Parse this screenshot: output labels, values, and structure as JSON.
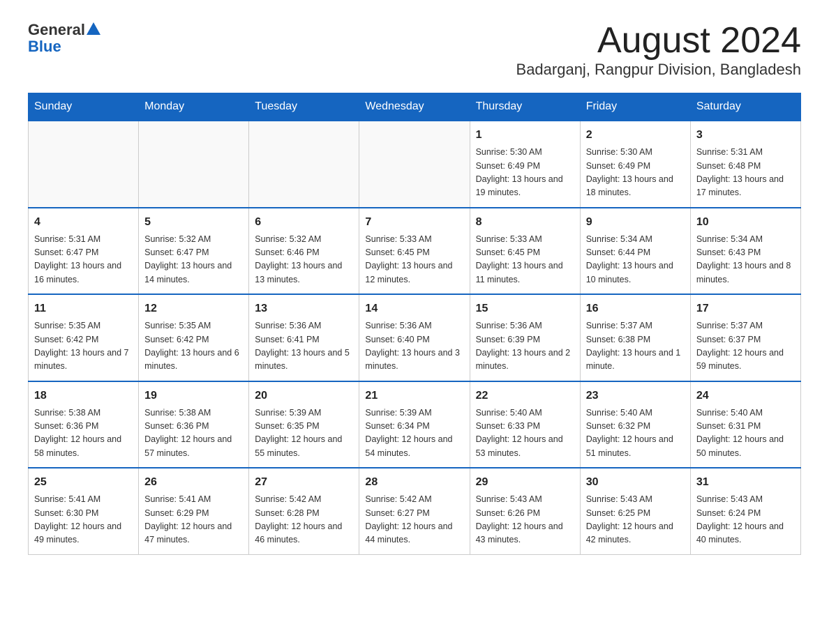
{
  "header": {
    "logo_general": "General",
    "logo_blue": "Blue",
    "month_title": "August 2024",
    "location": "Badarganj, Rangpur Division, Bangladesh"
  },
  "days_of_week": [
    "Sunday",
    "Monday",
    "Tuesday",
    "Wednesday",
    "Thursday",
    "Friday",
    "Saturday"
  ],
  "weeks": [
    [
      {
        "day": "",
        "sunrise": "",
        "sunset": "",
        "daylight": ""
      },
      {
        "day": "",
        "sunrise": "",
        "sunset": "",
        "daylight": ""
      },
      {
        "day": "",
        "sunrise": "",
        "sunset": "",
        "daylight": ""
      },
      {
        "day": "",
        "sunrise": "",
        "sunset": "",
        "daylight": ""
      },
      {
        "day": "1",
        "sunrise": "Sunrise: 5:30 AM",
        "sunset": "Sunset: 6:49 PM",
        "daylight": "Daylight: 13 hours and 19 minutes."
      },
      {
        "day": "2",
        "sunrise": "Sunrise: 5:30 AM",
        "sunset": "Sunset: 6:49 PM",
        "daylight": "Daylight: 13 hours and 18 minutes."
      },
      {
        "day": "3",
        "sunrise": "Sunrise: 5:31 AM",
        "sunset": "Sunset: 6:48 PM",
        "daylight": "Daylight: 13 hours and 17 minutes."
      }
    ],
    [
      {
        "day": "4",
        "sunrise": "Sunrise: 5:31 AM",
        "sunset": "Sunset: 6:47 PM",
        "daylight": "Daylight: 13 hours and 16 minutes."
      },
      {
        "day": "5",
        "sunrise": "Sunrise: 5:32 AM",
        "sunset": "Sunset: 6:47 PM",
        "daylight": "Daylight: 13 hours and 14 minutes."
      },
      {
        "day": "6",
        "sunrise": "Sunrise: 5:32 AM",
        "sunset": "Sunset: 6:46 PM",
        "daylight": "Daylight: 13 hours and 13 minutes."
      },
      {
        "day": "7",
        "sunrise": "Sunrise: 5:33 AM",
        "sunset": "Sunset: 6:45 PM",
        "daylight": "Daylight: 13 hours and 12 minutes."
      },
      {
        "day": "8",
        "sunrise": "Sunrise: 5:33 AM",
        "sunset": "Sunset: 6:45 PM",
        "daylight": "Daylight: 13 hours and 11 minutes."
      },
      {
        "day": "9",
        "sunrise": "Sunrise: 5:34 AM",
        "sunset": "Sunset: 6:44 PM",
        "daylight": "Daylight: 13 hours and 10 minutes."
      },
      {
        "day": "10",
        "sunrise": "Sunrise: 5:34 AM",
        "sunset": "Sunset: 6:43 PM",
        "daylight": "Daylight: 13 hours and 8 minutes."
      }
    ],
    [
      {
        "day": "11",
        "sunrise": "Sunrise: 5:35 AM",
        "sunset": "Sunset: 6:42 PM",
        "daylight": "Daylight: 13 hours and 7 minutes."
      },
      {
        "day": "12",
        "sunrise": "Sunrise: 5:35 AM",
        "sunset": "Sunset: 6:42 PM",
        "daylight": "Daylight: 13 hours and 6 minutes."
      },
      {
        "day": "13",
        "sunrise": "Sunrise: 5:36 AM",
        "sunset": "Sunset: 6:41 PM",
        "daylight": "Daylight: 13 hours and 5 minutes."
      },
      {
        "day": "14",
        "sunrise": "Sunrise: 5:36 AM",
        "sunset": "Sunset: 6:40 PM",
        "daylight": "Daylight: 13 hours and 3 minutes."
      },
      {
        "day": "15",
        "sunrise": "Sunrise: 5:36 AM",
        "sunset": "Sunset: 6:39 PM",
        "daylight": "Daylight: 13 hours and 2 minutes."
      },
      {
        "day": "16",
        "sunrise": "Sunrise: 5:37 AM",
        "sunset": "Sunset: 6:38 PM",
        "daylight": "Daylight: 13 hours and 1 minute."
      },
      {
        "day": "17",
        "sunrise": "Sunrise: 5:37 AM",
        "sunset": "Sunset: 6:37 PM",
        "daylight": "Daylight: 12 hours and 59 minutes."
      }
    ],
    [
      {
        "day": "18",
        "sunrise": "Sunrise: 5:38 AM",
        "sunset": "Sunset: 6:36 PM",
        "daylight": "Daylight: 12 hours and 58 minutes."
      },
      {
        "day": "19",
        "sunrise": "Sunrise: 5:38 AM",
        "sunset": "Sunset: 6:36 PM",
        "daylight": "Daylight: 12 hours and 57 minutes."
      },
      {
        "day": "20",
        "sunrise": "Sunrise: 5:39 AM",
        "sunset": "Sunset: 6:35 PM",
        "daylight": "Daylight: 12 hours and 55 minutes."
      },
      {
        "day": "21",
        "sunrise": "Sunrise: 5:39 AM",
        "sunset": "Sunset: 6:34 PM",
        "daylight": "Daylight: 12 hours and 54 minutes."
      },
      {
        "day": "22",
        "sunrise": "Sunrise: 5:40 AM",
        "sunset": "Sunset: 6:33 PM",
        "daylight": "Daylight: 12 hours and 53 minutes."
      },
      {
        "day": "23",
        "sunrise": "Sunrise: 5:40 AM",
        "sunset": "Sunset: 6:32 PM",
        "daylight": "Daylight: 12 hours and 51 minutes."
      },
      {
        "day": "24",
        "sunrise": "Sunrise: 5:40 AM",
        "sunset": "Sunset: 6:31 PM",
        "daylight": "Daylight: 12 hours and 50 minutes."
      }
    ],
    [
      {
        "day": "25",
        "sunrise": "Sunrise: 5:41 AM",
        "sunset": "Sunset: 6:30 PM",
        "daylight": "Daylight: 12 hours and 49 minutes."
      },
      {
        "day": "26",
        "sunrise": "Sunrise: 5:41 AM",
        "sunset": "Sunset: 6:29 PM",
        "daylight": "Daylight: 12 hours and 47 minutes."
      },
      {
        "day": "27",
        "sunrise": "Sunrise: 5:42 AM",
        "sunset": "Sunset: 6:28 PM",
        "daylight": "Daylight: 12 hours and 46 minutes."
      },
      {
        "day": "28",
        "sunrise": "Sunrise: 5:42 AM",
        "sunset": "Sunset: 6:27 PM",
        "daylight": "Daylight: 12 hours and 44 minutes."
      },
      {
        "day": "29",
        "sunrise": "Sunrise: 5:43 AM",
        "sunset": "Sunset: 6:26 PM",
        "daylight": "Daylight: 12 hours and 43 minutes."
      },
      {
        "day": "30",
        "sunrise": "Sunrise: 5:43 AM",
        "sunset": "Sunset: 6:25 PM",
        "daylight": "Daylight: 12 hours and 42 minutes."
      },
      {
        "day": "31",
        "sunrise": "Sunrise: 5:43 AM",
        "sunset": "Sunset: 6:24 PM",
        "daylight": "Daylight: 12 hours and 40 minutes."
      }
    ]
  ]
}
